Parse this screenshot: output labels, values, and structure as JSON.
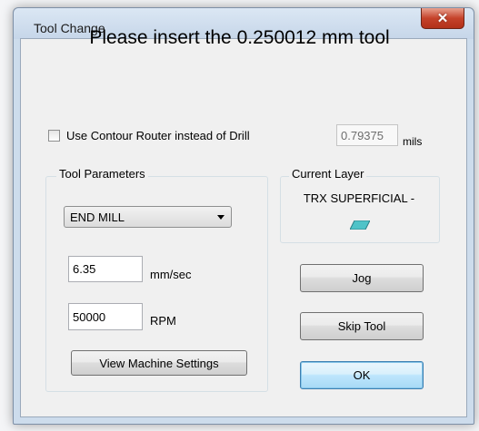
{
  "window": {
    "title": "Tool Change",
    "close_glyph": "✕"
  },
  "heading": "Please insert the 0.250012 mm tool",
  "contour_router": {
    "label": "Use Contour Router instead of Drill",
    "checked": false,
    "value": "0.79375",
    "unit": "mils"
  },
  "tool_parameters": {
    "group_label": "Tool Parameters",
    "tool_type": "END MILL",
    "feed_value": "6.35",
    "feed_unit": "mm/sec",
    "speed_value": "50000",
    "speed_unit": "RPM",
    "view_settings_label": "View Machine Settings"
  },
  "current_layer": {
    "group_label": "Current Layer",
    "name": "TRX SUPERFICIAL -",
    "swatch_color": "#4fc3c8"
  },
  "buttons": {
    "jog": "Jog",
    "skip_tool": "Skip Tool",
    "ok": "OK"
  },
  "colors": {
    "titlebar": "#c6d6e9",
    "close_button": "#c5432b",
    "default_button_border": "#3c7fb1"
  }
}
